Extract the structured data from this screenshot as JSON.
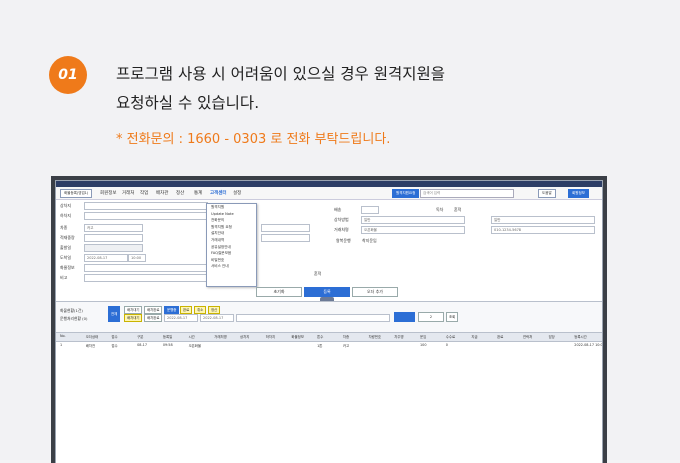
{
  "header": {
    "step": "01",
    "message_line1": "프로그램 사용 시 어려움이 있으실 경우 원격지원을",
    "message_line2": "요청하실 수 있습니다.",
    "phone_note": "* 전화문의 : 1660 - 0303 로 전화 부탁드립니다."
  },
  "app": {
    "menu": [
      "회원정보",
      "거래처",
      "작업",
      "배차관",
      "정산",
      "통계",
      "고객센터",
      "설정"
    ],
    "active_menu": "고객센터",
    "left_button": "화물등록(영업1)",
    "right_buttons": [
      "원격지원요청",
      "도움말",
      "회원정보"
    ],
    "search_placeholder": "검색어 입력",
    "dropdown_items": [
      "원격지원",
      "Update Note",
      "전화문의",
      "원격지원 요청",
      "설치안내",
      "거래내역",
      "공유설정안내",
      "FAQ질문모음",
      "비밀번호",
      "서비스 안내"
    ],
    "form_labels_left": [
      "상차지",
      "하차지",
      "차종",
      "적재중량",
      "출발일",
      "도착일",
      "화물정보",
      "비고"
    ],
    "form_labels_right": [
      "배송",
      "상차방법",
      "거래처명",
      "운임"
    ],
    "form_values": {
      "vehicle": "카고",
      "time": "10:00",
      "date": "2022-08-17",
      "method": "일반",
      "client": "오픈화물",
      "phone": "010-1234-5678"
    },
    "radio_labels": [
      "독차",
      "혼적"
    ],
    "check_labels": [
      "왕복운행",
      "착지운임"
    ],
    "action_buttons": [
      "초기화",
      "등록",
      "오더 추가"
    ],
    "lower": {
      "label1": "화물현황(1건)",
      "label2": "운행처리현황 (0)",
      "chips": [
        "전체",
        "배차대기",
        "배차완료",
        "운행중",
        "완료",
        "취소",
        "정산"
      ],
      "date_from": "2022-08-17",
      "date_to": "2022-08-17",
      "page": "2",
      "btn_search": "조회",
      "btn_excel": "엑셀"
    },
    "grid_columns": [
      "No.",
      "오더상태",
      "접수",
      "구분",
      "등록일",
      "시간",
      "거래처명",
      "상차지",
      "하차지",
      "화물정보",
      "톤수",
      "차종",
      "차량번호",
      "차주명",
      "운임",
      "수수료",
      "지급",
      "완료",
      "연락처",
      "담당",
      "등록시간"
    ],
    "grid_rows": [
      [
        "1",
        "배차전",
        "접수",
        "08-17",
        "09:58",
        "오픈화물",
        "",
        "",
        "",
        "",
        "1톤",
        "카고",
        "",
        "",
        "100",
        "0",
        "",
        "",
        "",
        "",
        "2022-08-17 10:00"
      ]
    ]
  }
}
